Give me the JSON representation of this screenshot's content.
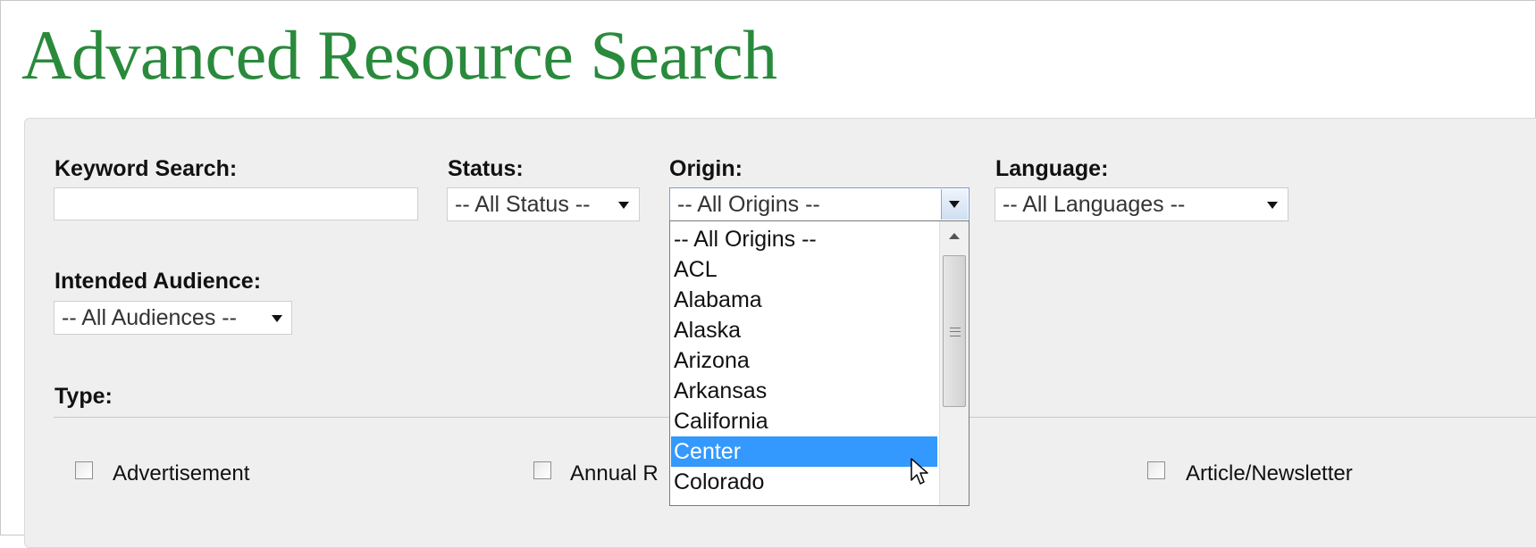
{
  "page": {
    "title": "Advanced Resource Search"
  },
  "filters": {
    "keyword": {
      "label": "Keyword Search:",
      "value": ""
    },
    "status": {
      "label": "Status:",
      "selected": "-- All Status --"
    },
    "origin": {
      "label": "Origin:",
      "selected": "-- All Origins --",
      "options": [
        "-- All Origins --",
        "ACL",
        "Alabama",
        "Alaska",
        "Arizona",
        "Arkansas",
        "California",
        "Center",
        "Colorado"
      ],
      "highlighted": "Center"
    },
    "language": {
      "label": "Language:",
      "selected": "-- All Languages --"
    },
    "audience": {
      "label": "Intended Audience:",
      "selected": "-- All Audiences --"
    }
  },
  "type": {
    "label": "Type:",
    "checkboxes": [
      "Advertisement",
      "Annual R",
      "Article/Newsletter"
    ]
  },
  "colors": {
    "title_green": "#2a8a3c",
    "panel_bg": "#efefef",
    "highlight": "#3399ff"
  }
}
